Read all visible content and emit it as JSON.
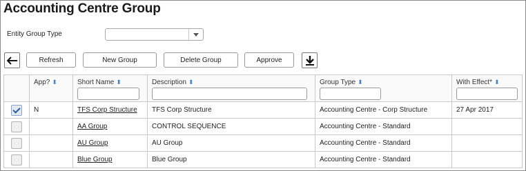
{
  "page": {
    "title": "Accounting Centre Group"
  },
  "filter": {
    "label": "Entity Group Type",
    "value": ""
  },
  "toolbar": {
    "back_icon": "arrow-left-icon",
    "refresh_label": "Refresh",
    "new_group_label": "New Group",
    "delete_group_label": "Delete Group",
    "approve_label": "Approve",
    "download_icon": "download-icon"
  },
  "table": {
    "columns": [
      {
        "label": "",
        "filter": false
      },
      {
        "label": "App?",
        "filter": false
      },
      {
        "label": "Short Name",
        "filter": true
      },
      {
        "label": "Description",
        "filter": true
      },
      {
        "label": "Group Type",
        "filter": true
      },
      {
        "label": "With Effect*",
        "filter": true
      }
    ],
    "rows": [
      {
        "checked": true,
        "app": "N",
        "short_name": "TFS Corp Structure",
        "description": "TFS Corp Structure",
        "group_type": "Accounting Centre - Corp Structure",
        "with_effect": "27 Apr 2017"
      },
      {
        "checked": false,
        "app": "",
        "short_name": "AA Group",
        "description": "CONTROL SEQUENCE",
        "group_type": "Accounting Centre - Standard",
        "with_effect": ""
      },
      {
        "checked": false,
        "app": "",
        "short_name": "AU Group",
        "description": "AU Group",
        "group_type": "Accounting Centre - Standard",
        "with_effect": ""
      },
      {
        "checked": false,
        "app": "",
        "short_name": "Blue Group",
        "description": "Blue Group",
        "group_type": "Accounting Centre - Standard",
        "with_effect": ""
      }
    ]
  },
  "colors": {
    "sort_icon": "#3d7bc6",
    "border": "#c9c9c9"
  }
}
